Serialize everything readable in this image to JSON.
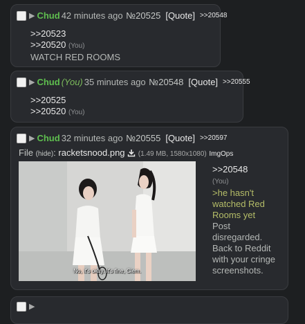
{
  "posts": [
    {
      "name": "Chud",
      "time": "42 minutes ago",
      "number": "№20525",
      "quote_label": "[Quote]",
      "reply": ">>20548",
      "lines": [
        {
          "text": ">>20523"
        },
        {
          "text": ">>20520",
          "you": "(You)"
        },
        {
          "text": "WATCH RED ROOMS"
        }
      ]
    },
    {
      "name": "Chud",
      "you": "(You)",
      "time": "35 minutes ago",
      "number": "№20548",
      "quote_label": "[Quote]",
      "reply": ">>20555",
      "lines": [
        {
          "text": ">>20525"
        },
        {
          "text": ">>20520",
          "you": "(You)"
        }
      ]
    },
    {
      "name": "Chud",
      "time": "32 minutes ago",
      "number": "№20555",
      "quote_label": "[Quote]",
      "reply": ">>20597",
      "file": {
        "prefix": "File",
        "hide": "(hide)",
        "name": "racketsnood.png",
        "meta": "(1.49 MB, 1580x1080)",
        "imgops": "ImgOps",
        "subtitle": "No, it's okay. It's fine, Clem."
      },
      "lines": [
        {
          "text": ">>20548"
        },
        {
          "text": "(You)"
        },
        {
          "text": ">he hasn't watched Red Rooms yet"
        },
        {
          "text": "Post disregarded. Back to Reddit with your cringe screenshots."
        }
      ]
    }
  ],
  "icons": {
    "download": "download-icon",
    "expand": "triangle-right-icon"
  },
  "colors": {
    "background": "#1d1f21",
    "post": "#282a2e",
    "name": "#5fbf4f",
    "greentext": "#b5bd68"
  }
}
